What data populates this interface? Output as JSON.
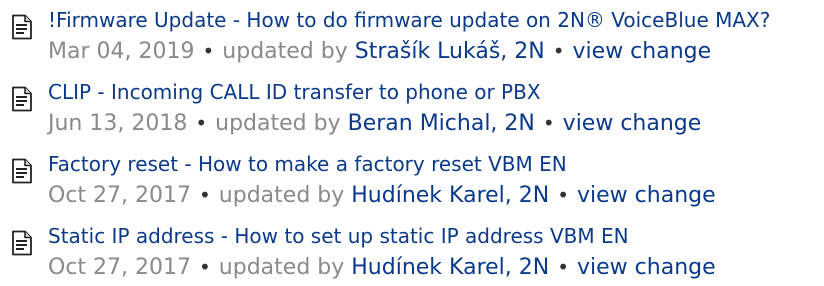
{
  "icon": "document-icon",
  "colors": {
    "link": "#0b3a8a",
    "meta_text": "#8a8a8a",
    "bullet": "#333333"
  },
  "items": [
    {
      "title": "!Firmware Update - How to do firmware update on 2N® VoiceBlue MAX?",
      "date": "Mar 04, 2019",
      "bullet": "•",
      "updated_by": "updated by",
      "author": "Strašík Lukáš, 2N",
      "view_change": "view change"
    },
    {
      "title": "CLIP - Incoming CALL ID transfer to phone or PBX",
      "date": "Jun 13, 2018",
      "bullet": "•",
      "updated_by": "updated by",
      "author": "Beran Michal, 2N",
      "view_change": "view change"
    },
    {
      "title": "Factory reset - How to make a factory reset VBM EN",
      "date": "Oct 27, 2017",
      "bullet": "•",
      "updated_by": "updated by",
      "author": "Hudínek Karel, 2N",
      "view_change": "view change"
    },
    {
      "title": "Static IP address - How to set up static IP address VBM EN",
      "date": "Oct 27, 2017",
      "bullet": "•",
      "updated_by": "updated by",
      "author": "Hudínek Karel, 2N",
      "view_change": "view change"
    }
  ]
}
